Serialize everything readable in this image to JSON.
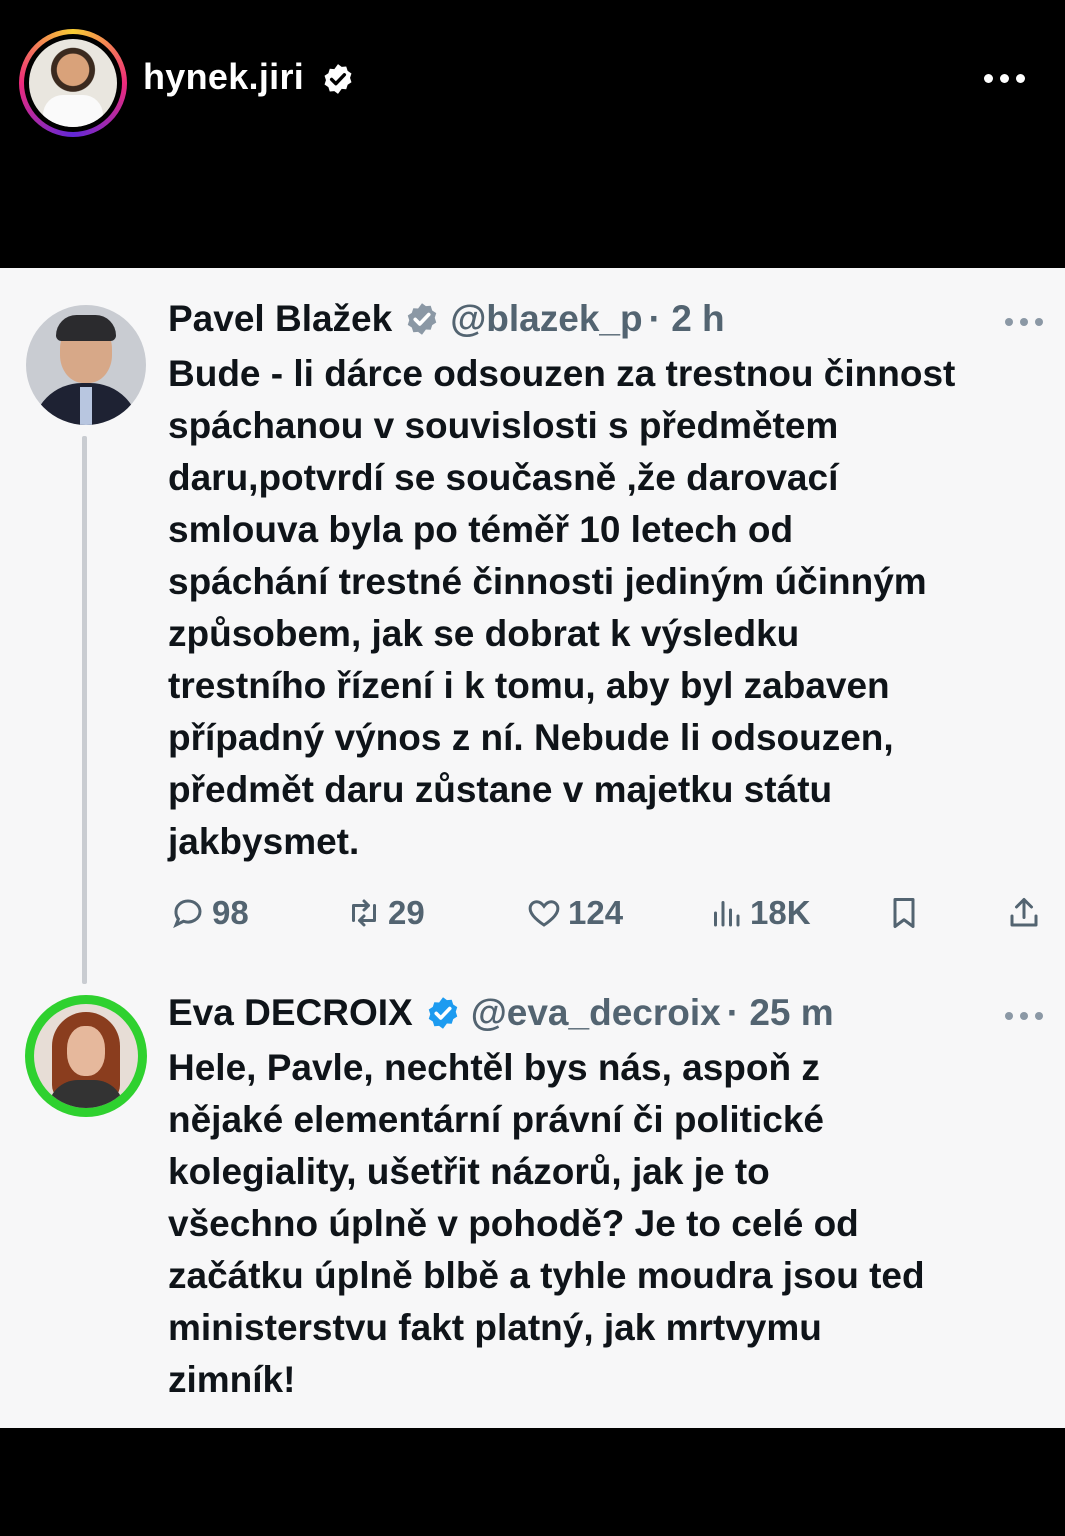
{
  "story": {
    "username": "hynek.jiri"
  },
  "tweets": [
    {
      "author": "Pavel Blažek",
      "handle": "@blazek_p",
      "time": "· 2 h",
      "lines": [
        "Bude - li dárce odsouzen za trestnou činnost",
        "spáchanou v souvislosti s předmětem",
        "daru,potvrdí  se současně ,že darovací",
        "smlouva byla po téměř 10 letech od",
        "spáchání trestné činnosti jediným účinným",
        "způsobem, jak se dobrat k výsledku",
        "trestního řízení i k tomu, aby byl zabaven",
        "případný výnos z ní. Nebude li odsouzen,",
        "předmět daru zůstane v majetku státu",
        "jakbysmet."
      ],
      "stats": {
        "replies": "98",
        "retweets": "29",
        "likes": "124",
        "views": "18K"
      }
    },
    {
      "author": "Eva DECROIX",
      "handle": "@eva_decroix",
      "time": "· 25 m",
      "lines": [
        "Hele, Pavle, nechtěl bys nás, aspoň z",
        "nějaké elementární právní či politické",
        "kolegiality, ušetřit názorů, jak je to",
        "všechno úplně v pohodě? Je to celé od",
        "začátku úplně blbě a tyhle moudra jsou ted",
        "ministerstvu fakt platný, jak mrtvymu",
        "zimník!"
      ]
    }
  ],
  "colors": {
    "badge_gray": "#8b98a5",
    "badge_blue": "#1d9bf0",
    "ring_green": "#2fd12f",
    "text_secondary": "#536471"
  }
}
